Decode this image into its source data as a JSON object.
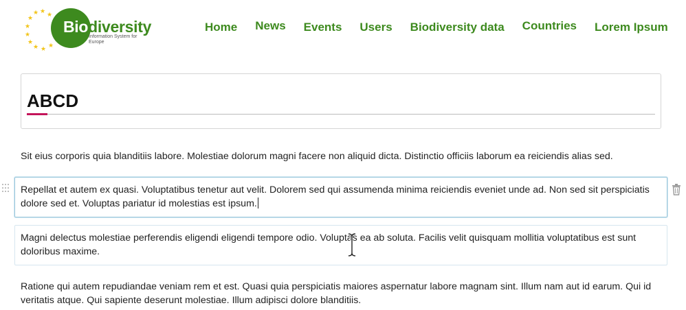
{
  "header": {
    "logo": {
      "title_first": "Bio",
      "title_rest": "diversity",
      "subtitle": "Information System for Europe"
    },
    "nav": [
      "Home",
      "News",
      "Events",
      "Users",
      "Biodiversity data",
      "Countries",
      "Lorem Ipsum"
    ]
  },
  "page": {
    "title": "ABCD",
    "paragraphs": [
      "Sit eius corporis quia blanditiis labore. Molestiae dolorum  magni facere non aliquid dicta. Distinctio officiis laborum ea  reiciendis alias sed.",
      "Repellat et autem ex quasi. Voluptatibus tenetur aut velit.  Dolorem sed qui assumenda minima reiciendis eveniet unde ad. Non sed sit perspiciatis dolore sed et. Voluptas pariatur id molestias est ipsum.",
      "Magni delectus molestiae perferendis eligendi eligendi tempore  odio. Voluptas ea ab soluta. Facilis velit quisquam mollitia  voluptatibus est sunt doloribus maxime.",
      "Ratione qui autem repudiandae veniam rem et est. Quasi quia  perspiciatis maiores aspernatur labore magnam sint. Illum nam aut id earum. Qui id veritatis atque. Qui sapiente deserunt molestiae. Illum  adipisci dolore blanditiis."
    ]
  },
  "colors": {
    "brand_green": "#3d8a1e",
    "star_yellow": "#f2c51b",
    "title_accent": "#c4145a",
    "selected_block_border": "#9cc8dc"
  },
  "icons": [
    "eu-stars-icon",
    "drag-handle-icon",
    "trash-icon",
    "text-cursor-icon"
  ]
}
